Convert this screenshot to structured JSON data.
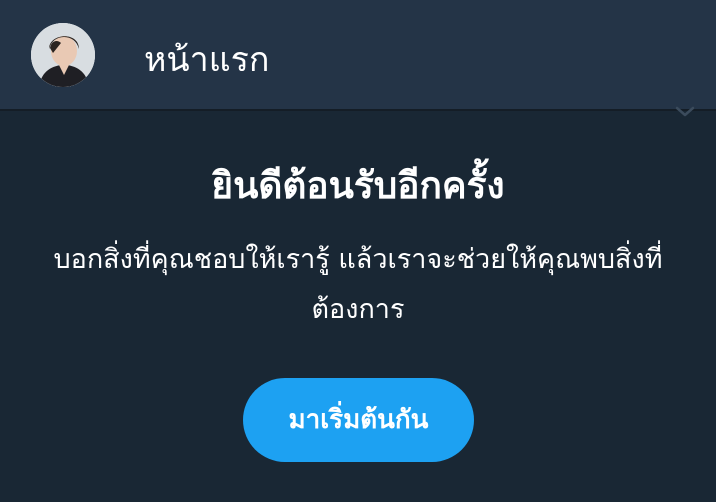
{
  "header": {
    "title": "หน้าแรก"
  },
  "welcome": {
    "title": "ยินดีต้อนรับอีกครั้ง",
    "description": "บอกสิ่งที่คุณชอบให้เรารู้ แล้วเราจะช่วยให้คุณพบสิ่งที่ต้องการ",
    "cta_label": "มาเริ่มต้นกัน"
  },
  "colors": {
    "header_bg": "#243447",
    "main_bg": "#192734",
    "accent": "#1da1f2",
    "text": "#ffffff"
  },
  "icons": {
    "avatar": "profile-avatar",
    "chevron": "chevron-down-icon"
  }
}
